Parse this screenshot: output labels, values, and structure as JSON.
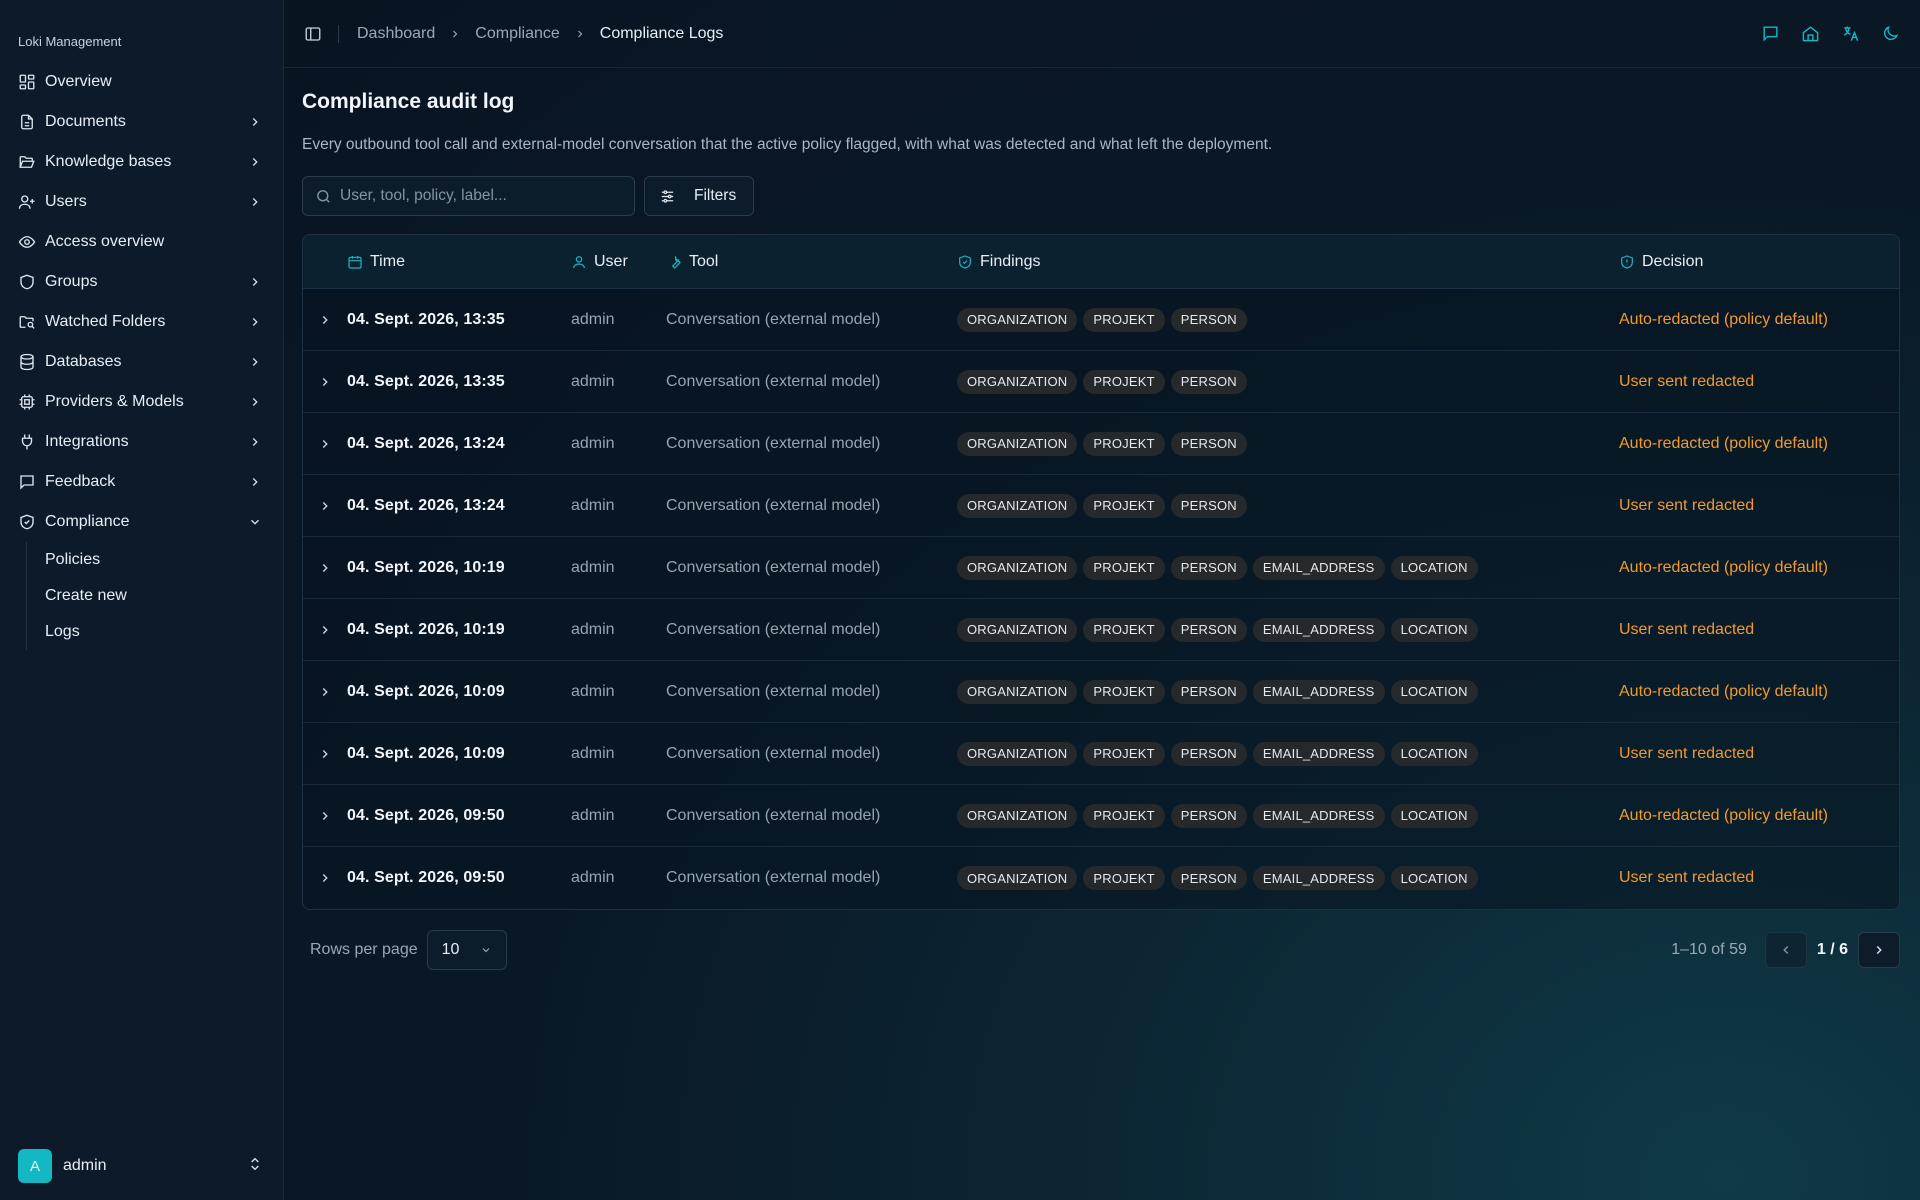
{
  "sidebar": {
    "brand": "Loki Management",
    "items": [
      {
        "label": "Overview",
        "icon": "layout-grid-icon",
        "chevron": false
      },
      {
        "label": "Documents",
        "icon": "file-text-icon",
        "chevron": true
      },
      {
        "label": "Knowledge bases",
        "icon": "folder-open-icon",
        "chevron": true
      },
      {
        "label": "Users",
        "icon": "user-plus-icon",
        "chevron": true
      },
      {
        "label": "Access overview",
        "icon": "eye-icon",
        "chevron": false
      },
      {
        "label": "Groups",
        "icon": "shield-icon",
        "chevron": true
      },
      {
        "label": "Watched Folders",
        "icon": "folder-search-icon",
        "chevron": true
      },
      {
        "label": "Databases",
        "icon": "database-icon",
        "chevron": true
      },
      {
        "label": "Providers & Models",
        "icon": "cpu-icon",
        "chevron": true
      },
      {
        "label": "Integrations",
        "icon": "plug-icon",
        "chevron": true
      },
      {
        "label": "Feedback",
        "icon": "message-square-icon",
        "chevron": true
      },
      {
        "label": "Compliance",
        "icon": "shield-check-icon",
        "chevron": "down"
      }
    ],
    "compliance_sub": [
      "Policies",
      "Create new",
      "Logs"
    ],
    "user": {
      "initial": "A",
      "name": "admin"
    }
  },
  "breadcrumb": [
    "Dashboard",
    "Compliance",
    "Compliance Logs"
  ],
  "page": {
    "title": "Compliance audit log",
    "description": "Every outbound tool call and external-model conversation that the active policy flagged, with what was detected and what left the deployment."
  },
  "search": {
    "placeholder": "User, tool, policy, label...",
    "value": ""
  },
  "filters_label": "Filters",
  "table": {
    "headers": {
      "time": "Time",
      "user": "User",
      "tool": "Tool",
      "findings": "Findings",
      "decision": "Decision"
    },
    "rows": [
      {
        "time": "04. Sept. 2026, 13:35",
        "user": "admin",
        "tool": "Conversation (external model)",
        "findings": [
          "ORGANIZATION",
          "PROJEKT",
          "PERSON"
        ],
        "decision": "Auto-redacted (policy default)"
      },
      {
        "time": "04. Sept. 2026, 13:35",
        "user": "admin",
        "tool": "Conversation (external model)",
        "findings": [
          "ORGANIZATION",
          "PROJEKT",
          "PERSON"
        ],
        "decision": "User sent redacted"
      },
      {
        "time": "04. Sept. 2026, 13:24",
        "user": "admin",
        "tool": "Conversation (external model)",
        "findings": [
          "ORGANIZATION",
          "PROJEKT",
          "PERSON"
        ],
        "decision": "Auto-redacted (policy default)"
      },
      {
        "time": "04. Sept. 2026, 13:24",
        "user": "admin",
        "tool": "Conversation (external model)",
        "findings": [
          "ORGANIZATION",
          "PROJEKT",
          "PERSON"
        ],
        "decision": "User sent redacted"
      },
      {
        "time": "04. Sept. 2026, 10:19",
        "user": "admin",
        "tool": "Conversation (external model)",
        "findings": [
          "ORGANIZATION",
          "PROJEKT",
          "PERSON",
          "EMAIL_ADDRESS",
          "LOCATION"
        ],
        "decision": "Auto-redacted (policy default)"
      },
      {
        "time": "04. Sept. 2026, 10:19",
        "user": "admin",
        "tool": "Conversation (external model)",
        "findings": [
          "ORGANIZATION",
          "PROJEKT",
          "PERSON",
          "EMAIL_ADDRESS",
          "LOCATION"
        ],
        "decision": "User sent redacted"
      },
      {
        "time": "04. Sept. 2026, 10:09",
        "user": "admin",
        "tool": "Conversation (external model)",
        "findings": [
          "ORGANIZATION",
          "PROJEKT",
          "PERSON",
          "EMAIL_ADDRESS",
          "LOCATION"
        ],
        "decision": "Auto-redacted (policy default)"
      },
      {
        "time": "04. Sept. 2026, 10:09",
        "user": "admin",
        "tool": "Conversation (external model)",
        "findings": [
          "ORGANIZATION",
          "PROJEKT",
          "PERSON",
          "EMAIL_ADDRESS",
          "LOCATION"
        ],
        "decision": "User sent redacted"
      },
      {
        "time": "04. Sept. 2026, 09:50",
        "user": "admin",
        "tool": "Conversation (external model)",
        "findings": [
          "ORGANIZATION",
          "PROJEKT",
          "PERSON",
          "EMAIL_ADDRESS",
          "LOCATION"
        ],
        "decision": "Auto-redacted (policy default)"
      },
      {
        "time": "04. Sept. 2026, 09:50",
        "user": "admin",
        "tool": "Conversation (external model)",
        "findings": [
          "ORGANIZATION",
          "PROJEKT",
          "PERSON",
          "EMAIL_ADDRESS",
          "LOCATION"
        ],
        "decision": "User sent redacted"
      }
    ]
  },
  "pagination": {
    "rows_per_page_label": "Rows per page",
    "rows_per_page": "10",
    "range": "1–10 of 59",
    "page_indicator": "1 / 6"
  },
  "colors": {
    "accent": "#14b8c4",
    "decision": "#f29a2e",
    "tag_bg": "#26292b"
  }
}
